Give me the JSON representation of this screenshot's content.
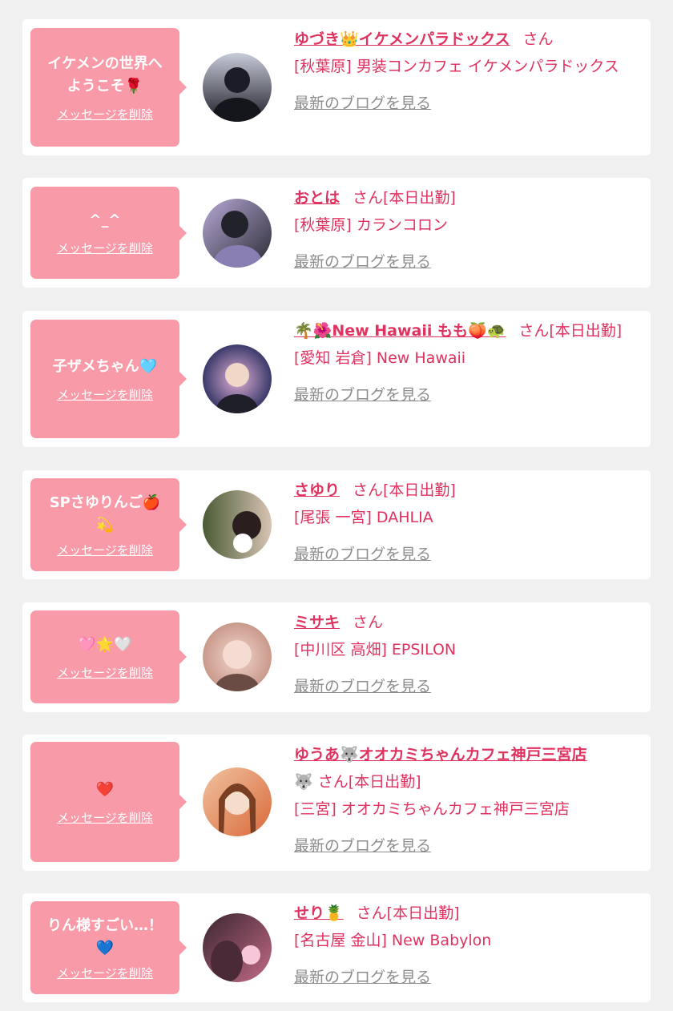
{
  "entries": [
    {
      "message": "イケメンの世界へ\nようこそ🌹",
      "delete_label": "メッセージを削除",
      "name": "ゆづき👑イケメンパラドックス",
      "suffix": "さん",
      "shop": "[秋葉原] 男装コンカフェ イケメンパラドックス",
      "blog_label": "最新のブログを見る",
      "avatar_colors": [
        "#1c1c28",
        "#c8ccd8"
      ]
    },
    {
      "message": "^_^",
      "delete_label": "メッセージを削除",
      "name": "おとは",
      "suffix": "さん[本日出勤]",
      "shop": "[秋葉原] カランコロン",
      "blog_label": "最新のブログを見る",
      "avatar_colors": [
        "#2a2a34",
        "#b7a9d6"
      ]
    },
    {
      "message": "子ザメちゃん🩵",
      "delete_label": "メッセージを削除",
      "name": "🌴🌺New Hawaii もも🍑🐢",
      "suffix": "さん[本日出勤]",
      "shop": "[愛知 岩倉] New Hawaii",
      "blog_label": "最新のブログを見る",
      "avatar_colors": [
        "#3b3a6a",
        "#e0b0d6"
      ]
    },
    {
      "message": "SPさゆりんご🍎\n💫",
      "delete_label": "メッセージを削除",
      "name": "さゆり",
      "suffix": "さん[本日出勤]",
      "shop": "[尾張 一宮] DAHLIA",
      "blog_label": "最新のブログを見る",
      "avatar_colors": [
        "#4a5b34",
        "#d8c4b4"
      ]
    },
    {
      "message": "🩷🌟🤍",
      "delete_label": "メッセージを削除",
      "name": "ミサキ",
      "suffix": "さん",
      "shop": "[中川区 高畑] EPSILON",
      "blog_label": "最新のブログを見る",
      "avatar_colors": [
        "#c99a8c",
        "#f2d6cc"
      ]
    },
    {
      "message": "❤️",
      "delete_label": "メッセージを削除",
      "name": "ゆうあ🐺オオカミちゃんカフェ神戸三宮店",
      "suffix": "🐺 さん[本日出勤]",
      "shop": "[三宮] オオカミちゃんカフェ神戸三宮店",
      "blog_label": "最新のブログを見る",
      "avatar_colors": [
        "#d96a3a",
        "#f1c2a0"
      ]
    },
    {
      "message": "りん様すごい…！\n💙",
      "delete_label": "メッセージを削除",
      "name": "せり🍍",
      "suffix": "さん[本日出勤]",
      "shop": "[名古屋 金山] New Babylon",
      "blog_label": "最新のブログを見る",
      "avatar_colors": [
        "#3a2630",
        "#c26a86"
      ]
    }
  ]
}
